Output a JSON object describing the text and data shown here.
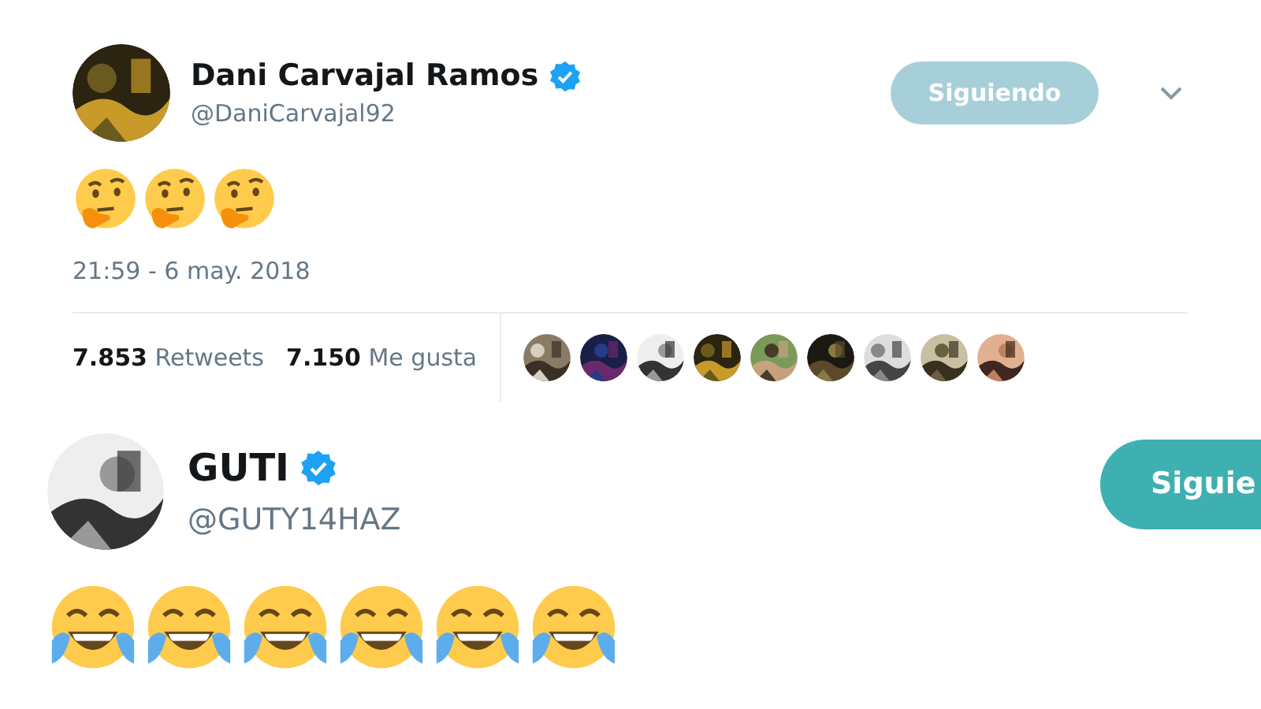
{
  "tweets": [
    {
      "name": "Dani Carvajal Ramos",
      "verified": true,
      "handle": "@DaniCarvajal92",
      "follow_button": {
        "label": "Siguiendo",
        "faded": true
      },
      "menu": true,
      "emojis": [
        {
          "kind": "thinking"
        },
        {
          "kind": "thinking"
        },
        {
          "kind": "thinking"
        }
      ],
      "timestamp": "21:59 - 6 may. 2018",
      "stats": [
        {
          "count": "7.853",
          "label": "Retweets"
        },
        {
          "count": "7.150",
          "label": "Me gusta"
        }
      ],
      "likers": [
        {
          "kind": "picture"
        },
        {
          "kind": "picture"
        },
        {
          "kind": "picture"
        },
        {
          "kind": "picture"
        },
        {
          "kind": "picture"
        },
        {
          "kind": "picture"
        },
        {
          "kind": "picture"
        },
        {
          "kind": "picture"
        },
        {
          "kind": "picture"
        }
      ]
    },
    {
      "name": "GUTI",
      "verified": true,
      "handle": "@GUTY14HAZ",
      "follow_button": {
        "label": "Siguie",
        "faded": false
      },
      "menu": false,
      "emojis": [
        {
          "kind": "laughing"
        },
        {
          "kind": "laughing"
        },
        {
          "kind": "laughing"
        },
        {
          "kind": "laughing"
        },
        {
          "kind": "laughing"
        },
        {
          "kind": "laughing"
        }
      ]
    }
  ]
}
